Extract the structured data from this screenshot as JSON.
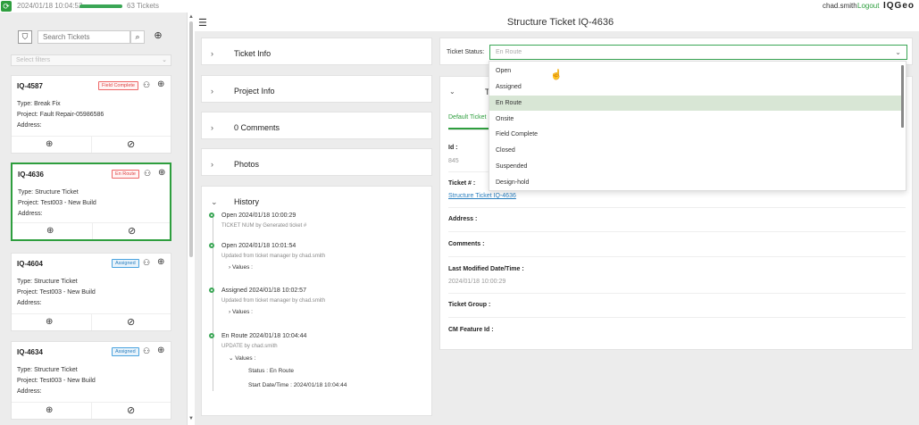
{
  "topbar": {
    "timestamp": "2024/01/18 10:04:52",
    "progress": 1.0,
    "tickets_count": "63 Tickets",
    "user": "chad.smith",
    "logout": "Logout",
    "logo": "IQGeo"
  },
  "sidebar": {
    "search_placeholder": "Search Tickets",
    "filters_placeholder": "Select filters",
    "cards": [
      {
        "id": "IQ-4587",
        "status": "Field Complete",
        "type": "Type: Break Fix",
        "project": "Project: Fault Repair-05986586",
        "address": "Address:"
      },
      {
        "id": "IQ-4636",
        "status": "En Route",
        "type": "Type: Structure Ticket",
        "project": "Project: Test003 - New Build",
        "address": "Address:"
      },
      {
        "id": "IQ-4604",
        "status": "Assigned",
        "type": "Type: Structure Ticket",
        "project": "Project: Test003 - New Build",
        "address": "Address:"
      },
      {
        "id": "IQ-4634",
        "status": "Assigned",
        "type": "Type: Structure Ticket",
        "project": "Project: Test003 - New Build",
        "address": "Address:"
      }
    ]
  },
  "header": {
    "title": "Structure Ticket IQ-4636"
  },
  "sections": {
    "ticket_info": "Ticket Info",
    "project_info": "Project Info",
    "comments": "0 Comments",
    "photos": "Photos",
    "history": "History"
  },
  "history": [
    {
      "head": "Open 2024/01/18 10:00:29",
      "sub": "TICKET NUM by Generated ticket #"
    },
    {
      "head": "Open 2024/01/18 10:01:54",
      "sub": "Updated from ticket manager by chad.smith",
      "values": "Values :"
    },
    {
      "head": "Assigned 2024/01/18 10:02:57",
      "sub": "Updated from ticket manager by chad.smith",
      "values": "Values :"
    },
    {
      "head": "En Route 2024/01/18 10:04:44",
      "sub": "UPDATE by chad.smith",
      "values": "Values :",
      "status": "Status : En Route",
      "start": "Start Date/Time : 2024/01/18 10:04:44"
    }
  ],
  "status": {
    "label": "Ticket Status:",
    "selected": "En Route",
    "options": [
      "Open",
      "Assigned",
      "En Route",
      "Onsite",
      "Field Complete",
      "Closed",
      "Suspended",
      "Design-hold"
    ]
  },
  "details": {
    "title": "T",
    "tab": "Default Ticket",
    "id_label": "Id :",
    "id_value": "845",
    "ticket_label": "Ticket # :",
    "ticket_value": "Structure Ticket IQ-4636",
    "address_label": "Address :",
    "comments_label": "Comments :",
    "modified_label": "Last Modified Date/Time :",
    "modified_value": "2024/01/18 10:00:29",
    "group_label": "Ticket Group :",
    "cm_label": "CM Feature Id :"
  }
}
